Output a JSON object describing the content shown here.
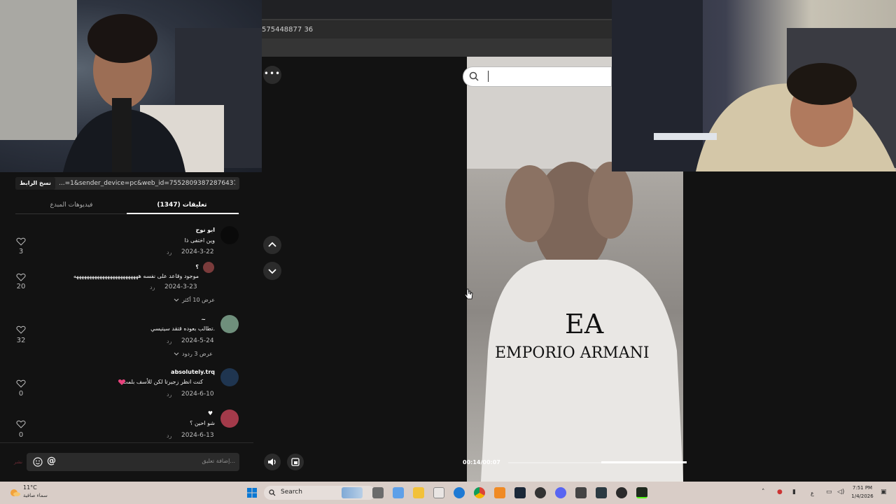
{
  "browser": {
    "url_fragment": "575448877 36"
  },
  "share": {
    "copy_label": "نسخ الرابط",
    "link_text": "...=1&sender_device=pc&web_id=7552809387287643704"
  },
  "tabs": {
    "comments_label": "تعليقات (1347)",
    "creator_videos_label": "فيديوهات المبدع"
  },
  "comments": [
    {
      "name": "ابو نوح",
      "text": "وين اختفى ذا",
      "date": "2024-3-22",
      "reply": "رد",
      "likes": "3"
    },
    {
      "name": "؟",
      "text": "موجود وقاعد على نفسه هههههههههههههههههههههههههه",
      "date": "2024-3-23",
      "reply": "رد",
      "likes": "20",
      "more": "عرض 10 أكثر"
    },
    {
      "name": "~",
      "text": "تطالب بعوده قتقد سيتيسي.",
      "date": "2024-5-24",
      "reply": "رد",
      "likes": "32",
      "more": "عرض 3 ردود"
    },
    {
      "name": "absolutely.trq",
      "text": "كنت انظر زجيرتا لكن للأسف بلمت",
      "date": "2024-6-10",
      "reply": "رد",
      "likes": "0"
    },
    {
      "name": "♥",
      "text": "شو احين ؟",
      "date": "2024-6-13",
      "reply": "رد",
      "likes": "0"
    }
  ],
  "composer": {
    "placeholder": "إضافة تعليق...",
    "post_label": "نشر"
  },
  "player": {
    "more_label": "•••",
    "time": "00:14/00:07",
    "progress": 0.48
  },
  "taskbar": {
    "temp": "11°C",
    "weather": "سماء صافية",
    "search_label": "Search",
    "lang": "ع",
    "time": "7:51 PM",
    "date": "1/4/2026"
  },
  "colors": {
    "accent_heart": "#e8427c",
    "taskbar": "#d9cdc7"
  }
}
